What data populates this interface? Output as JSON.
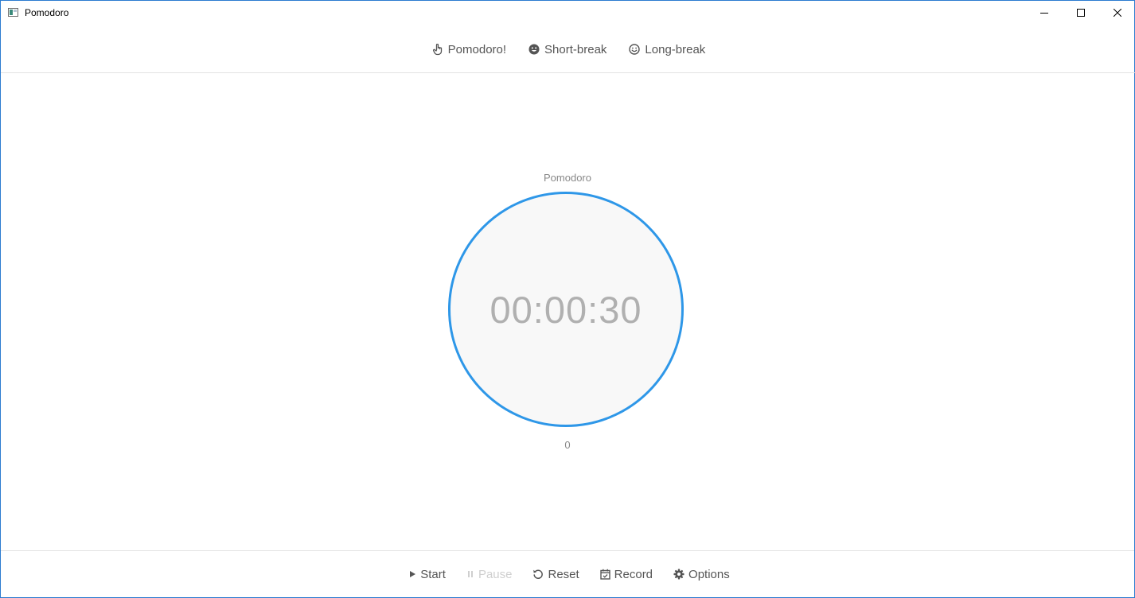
{
  "window": {
    "title": "Pomodoro",
    "app_icon": "window-app-icon",
    "controls": [
      "minimize-icon",
      "maximize-icon",
      "close-icon"
    ]
  },
  "tabs": [
    {
      "label": "Pomodoro!",
      "icon": "hand-pointer-icon"
    },
    {
      "label": "Short-break",
      "icon": "smile-filled-icon"
    },
    {
      "label": "Long-break",
      "icon": "smile-outline-icon"
    }
  ],
  "timer": {
    "mode_label": "Pomodoro",
    "time": "00:00:30",
    "count": "0",
    "ring_color": "#2e97e8"
  },
  "toolbar": {
    "start_label": "Start",
    "pause_label": "Pause",
    "reset_label": "Reset",
    "record_label": "Record",
    "options_label": "Options",
    "pause_disabled": true
  },
  "colors": {
    "accent": "#2e97e8",
    "text": "#555555",
    "disabled": "#cfcfcf",
    "timer_text": "#b0b0b0",
    "circle_fill": "#f8f8f8"
  }
}
